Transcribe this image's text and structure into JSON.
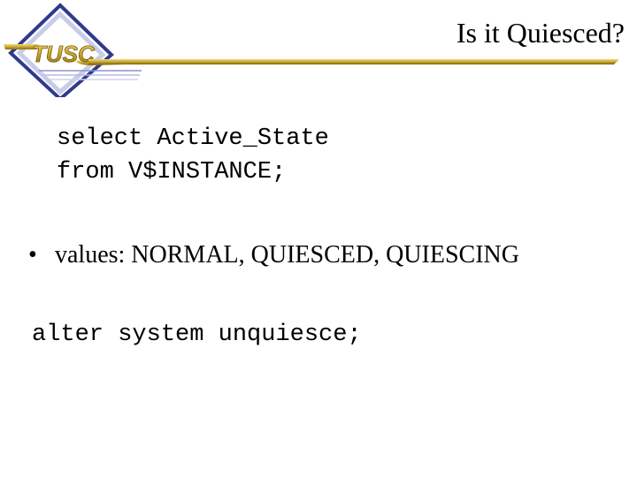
{
  "logo": {
    "text": "TUSC",
    "icon": "tusc-logo-icon",
    "colors": {
      "gold": "#C9A62E",
      "gold_dark": "#8A6E16",
      "blue": "#2E3A8C",
      "lavender": "#C8CCE8"
    }
  },
  "header": {
    "title": "Is it Quiesced?"
  },
  "content": {
    "code_query": [
      "select Active_State",
      "from V$INSTANCE;"
    ],
    "bullet": {
      "symbol": "•",
      "text": "values: NORMAL, QUIESCED, QUIESCING"
    },
    "code_command": "alter system unquiesce;"
  }
}
